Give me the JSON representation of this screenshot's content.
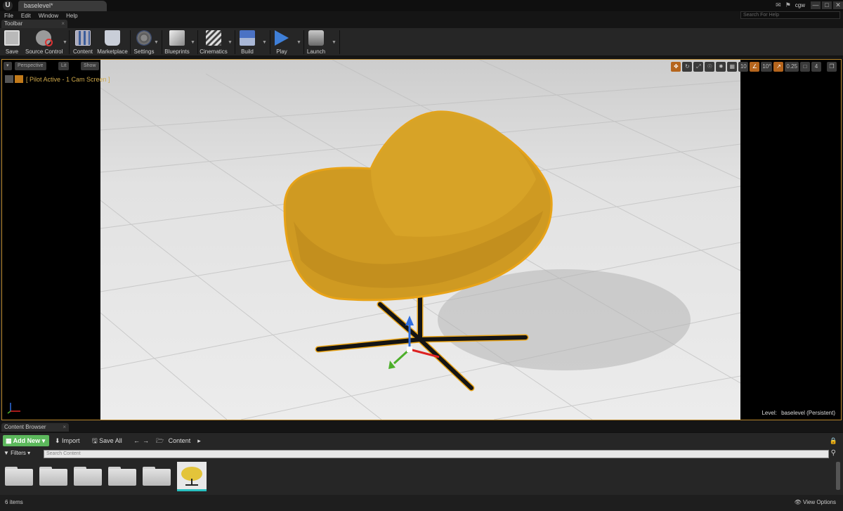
{
  "window": {
    "logo": "U",
    "tab_title": "baselevel*",
    "user": "cgw",
    "search_help_placeholder": "Search For Help"
  },
  "menu": {
    "items": [
      "File",
      "Edit",
      "Window",
      "Help"
    ]
  },
  "toolbar": {
    "tab_label": "Toolbar",
    "buttons": [
      {
        "label": "Save",
        "icon": "save-icon"
      },
      {
        "label": "Source Control",
        "icon": "source-control-icon"
      },
      {
        "label": "Content",
        "icon": "content-icon"
      },
      {
        "label": "Marketplace",
        "icon": "marketplace-icon"
      },
      {
        "label": "Settings",
        "icon": "settings-icon"
      },
      {
        "label": "Blueprints",
        "icon": "blueprints-icon"
      },
      {
        "label": "Cinematics",
        "icon": "cinematics-icon"
      },
      {
        "label": "Build",
        "icon": "build-icon"
      },
      {
        "label": "Play",
        "icon": "play-icon"
      },
      {
        "label": "Launch",
        "icon": "launch-icon"
      }
    ]
  },
  "viewport": {
    "perspective": "Perspective",
    "lit": "Lit",
    "show": "Show",
    "pilot_text": "[ Pilot Active - 1 Cam Screen ]",
    "grid_snap": "10",
    "rotation_snap": "10°",
    "scale_snap": "0.25",
    "camera_speed": "4",
    "level_label": "Level:",
    "level_name": "baselevel (Persistent)",
    "selection_color": "#e8a317",
    "chair_color": "#d9a520"
  },
  "content_browser": {
    "tab_label": "Content Browser",
    "add_new": "Add New",
    "import": "Import",
    "save_all": "Save All",
    "path": "Content",
    "filters": "Filters",
    "search_placeholder": "Search Content",
    "items_count": "6 items",
    "view_options": "View Options"
  }
}
